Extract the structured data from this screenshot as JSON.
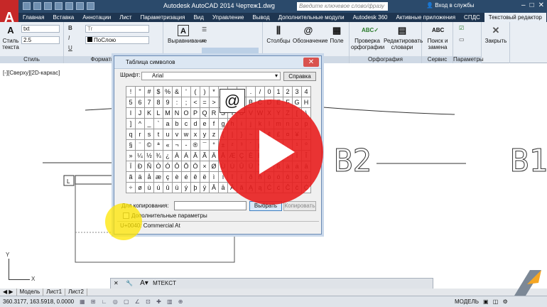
{
  "window": {
    "title": "Autodesk AutoCAD 2014   Чертеж1.dwg",
    "search_placeholder": "Введите ключевое слово/фразу",
    "login": "Вход в службы",
    "app_letter": "A"
  },
  "tabs": [
    "Главная",
    "Вставка",
    "Аннотации",
    "Лист",
    "Параметризация",
    "Вид",
    "Управление",
    "Вывод",
    "Дополнительные модули",
    "Autodesk 360",
    "Активные приложения",
    "СПДС",
    "Текстовый редактор"
  ],
  "ribbon": {
    "style_button": "Стиль текста",
    "style_name": "txt",
    "text_height": "2.5",
    "panel_style": "Стиль",
    "layer_color": "ПоСлою",
    "panel_format": "Форматирование",
    "align_button": "Выравнивание",
    "columns_button": "Столбцы",
    "symbol_button": "Обозначение",
    "field_button": "Поле",
    "panel_insert": "Вставка",
    "spell_button": "Проверка орфографии",
    "dict_button": "Редактировать словари",
    "panel_spell": "Орфография",
    "find_button": "Поиск и замена",
    "panel_tools": "Сервис",
    "panel_options": "Параметры",
    "close_button": "Закрыть"
  },
  "drawing": {
    "view_label": "[-][Сверху][2D-каркас]",
    "text_b2_left": "B2",
    "text_b2_right": "B1",
    "mtext_marker": "L"
  },
  "dialog": {
    "title": "Таблица символов",
    "font_label": "Шрифт:",
    "font_value": "Arial",
    "help_button": "Справка",
    "zoom_char": "@",
    "chars": [
      "!",
      "\"",
      "#",
      "$",
      "%",
      "&",
      "'",
      "(",
      ")",
      "*",
      "+",
      ",",
      "-",
      ".",
      "/",
      "0",
      "1",
      "2",
      "3",
      "4",
      "5",
      "6",
      "7",
      "8",
      "9",
      ":",
      ";",
      "<",
      "=",
      ">",
      "?",
      "@",
      "A",
      "B",
      "C",
      "D",
      "E",
      "F",
      "G",
      "H",
      "I",
      "J",
      "K",
      "L",
      "M",
      "N",
      "O",
      "P",
      "Q",
      "R",
      "S",
      "T",
      "U",
      "V",
      "W",
      "X",
      "Y",
      "Z",
      "[",
      "\\",
      "]",
      "^",
      "_",
      "`",
      "a",
      "b",
      "c",
      "d",
      "e",
      "f",
      "g",
      "h",
      "i",
      "j",
      "k",
      "l",
      "m",
      "n",
      "o",
      "p",
      "q",
      "r",
      "s",
      "t",
      "u",
      "v",
      "w",
      "x",
      "y",
      "z",
      "{",
      "|",
      "}",
      "~",
      "¡",
      "¢",
      "£",
      "¤",
      "¥",
      "¦",
      "§",
      "¨",
      "©",
      "ª",
      "«",
      "¬",
      "-",
      "®",
      "¯",
      "°",
      "±",
      "²",
      "³",
      "´",
      "µ",
      "¶",
      "·",
      "¸",
      "¹",
      "º",
      "»",
      "¼",
      "½",
      "¾",
      "¿",
      "À",
      "Á",
      "Â",
      "Ã",
      "Ä",
      "Å",
      "Æ",
      "Ç",
      "È",
      "É",
      "Ê",
      "Ë",
      "Ì",
      "Í",
      "Î",
      "Ï",
      "Ð",
      "Ñ",
      "Ò",
      "Ó",
      "Ô",
      "Õ",
      "Ö",
      "×",
      "Ø",
      "Ù",
      "Ú",
      "Û",
      "Ü",
      "Ý",
      "Þ",
      "ß",
      "à",
      "á",
      "â",
      "ã",
      "ä",
      "å",
      "æ",
      "ç",
      "è",
      "é",
      "ê",
      "ë",
      "ì",
      "í",
      "î",
      "ï",
      "ð",
      "ñ",
      "ò",
      "ó",
      "ô",
      "õ",
      "ö",
      "÷",
      "ø",
      "ù",
      "ú",
      "û",
      "ü",
      "ý",
      "þ",
      "ÿ",
      "Ā",
      "ā",
      "Ă",
      "ă",
      "Ą",
      "ą",
      "Ć",
      "ć",
      "Ĉ",
      "ĉ",
      "Ċ"
    ],
    "copy_label": "Для копирования:",
    "select_button": "Выбрать",
    "copy_button": "Копировать",
    "advanced_label": "Дополнительные параметры",
    "status": "U+0040: Commercial At"
  },
  "command": {
    "prompt": "MTEKCT"
  },
  "layouts": [
    "Модель",
    "Лист1",
    "Лист2"
  ],
  "status": {
    "coords": "360.3177, 163.5918, 0.0000",
    "model": "МОДЕЛЬ"
  },
  "colors": {
    "play": "#e81e1e",
    "highlight": "#ffe600",
    "titlebar": "#2b4a6b"
  }
}
